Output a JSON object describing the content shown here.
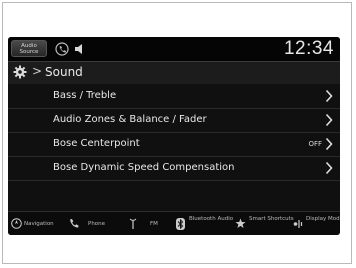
{
  "status": {
    "audio_source_label": "Audio Source",
    "time": "12:34"
  },
  "header": {
    "title": "Sound"
  },
  "menu": {
    "items": [
      {
        "label": "Bass / Treble",
        "value": ""
      },
      {
        "label": "Audio Zones & Balance / Fader",
        "value": ""
      },
      {
        "label": "Bose Centerpoint",
        "value": "OFF"
      },
      {
        "label": "Bose Dynamic Speed Compensation",
        "value": ""
      }
    ]
  },
  "bottom_bar": {
    "navigation": "Navigation",
    "phone": "Phone",
    "fm": "FM",
    "bluetooth_audio": "Bluetooth Audio",
    "smart_shortcuts": "Smart Shortcuts",
    "display_mode": "Display Mode"
  },
  "icons": [
    "phone-status-icon",
    "speaker-icon",
    "gear-icon",
    "chevron-right-icon",
    "compass-icon",
    "handset-icon",
    "antenna-icon",
    "bluetooth-icon",
    "star-icon",
    "display-icon"
  ],
  "colors": {
    "screen_bg": "#101010",
    "text": "#e8e8e8",
    "header_bg": "#1c1c1c"
  }
}
